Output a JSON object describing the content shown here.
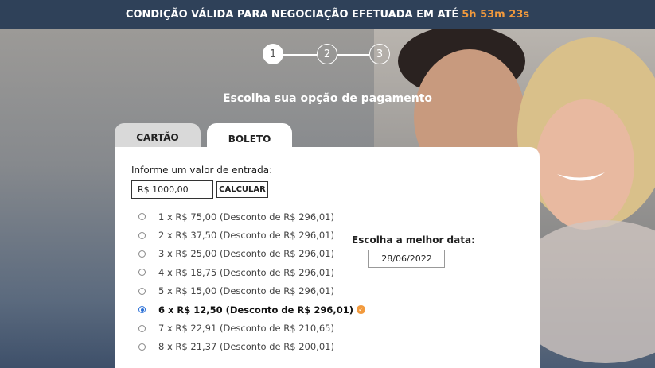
{
  "topbar": {
    "message": "CONDIÇÃO VÁLIDA PARA NEGOCIAÇÃO EFETUADA EM ATÉ",
    "timer": "5h 53m 23s",
    "timer_color": "#f29a3d"
  },
  "steps": [
    "1",
    "2",
    "3"
  ],
  "heading": "Escolha sua opção de pagamento",
  "tabs": {
    "card": "CARTÃO",
    "boleto": "BOLETO"
  },
  "entry": {
    "label": "Informe um valor de entrada:",
    "value": "R$ 1000,00",
    "calc_label": "CALCULAR"
  },
  "options": [
    "1 x R$ 75,00 (Desconto de R$ 296,01)",
    "2 x R$ 37,50 (Desconto de R$ 296,01)",
    "3 x R$ 25,00 (Desconto de R$ 296,01)",
    "4 x R$ 18,75 (Desconto de R$ 296,01)",
    "5 x R$ 15,00 (Desconto de R$ 296,01)",
    "6 x R$ 12,50 (Desconto de R$ 296,01)",
    "7 x R$ 22,91 (Desconto de R$ 210,65)",
    "8 x R$ 21,37 (Desconto de R$ 200,01)"
  ],
  "selected_option_index": 5,
  "date": {
    "label": "Escolha a melhor data:",
    "value": "28/06/2022"
  },
  "icons": {
    "recommended": "check-circle-icon"
  }
}
